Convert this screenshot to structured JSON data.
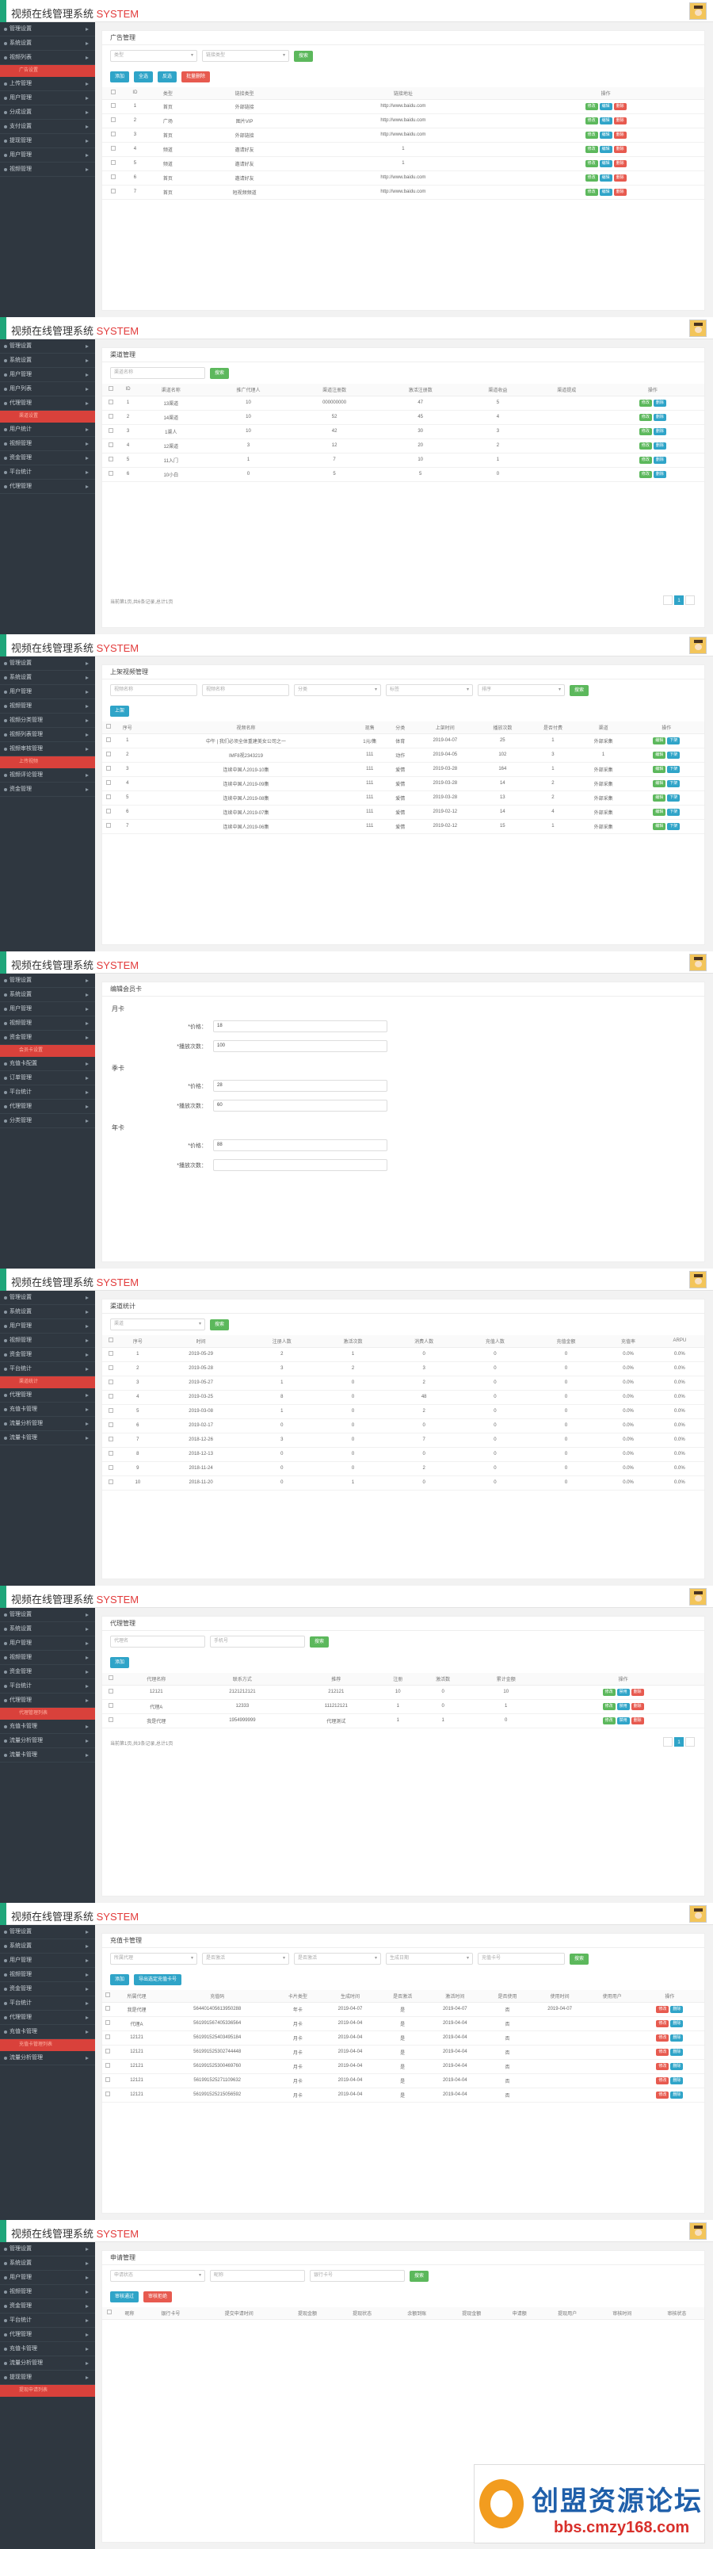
{
  "app": {
    "title": "视频在线管理系统",
    "title_en": "SYSTEM"
  },
  "watermark": {
    "brand": "创盟资源论坛",
    "url": "bbs.cmzy168.com"
  },
  "shot1": {
    "side": [
      "管理设置",
      "系统设置",
      "视频列表",
      "广告设置",
      "上传管理",
      "用户管理",
      "分成设置",
      "支付设置",
      "提现管理",
      "用户管理",
      "视频管理"
    ],
    "page_title": "广告管理",
    "filters": [
      "类型",
      "链接类型"
    ],
    "search": "搜索",
    "actions": [
      "添加",
      "全选",
      "反选",
      "批量删除"
    ],
    "headers": [
      "",
      "ID",
      "类型",
      "链接类型",
      "",
      "链接地址",
      "操作"
    ],
    "rows": [
      [
        "1",
        "首页",
        "外部链接",
        "",
        "http://www.baidu.com"
      ],
      [
        "2",
        "广场",
        "图片VIP",
        "",
        "http://www.baidu.com"
      ],
      [
        "3",
        "首页",
        "外部链接",
        "",
        "http://www.baidu.com"
      ],
      [
        "4",
        "频道",
        "邀请好友",
        "",
        "1"
      ],
      [
        "5",
        "频道",
        "邀请好友",
        "",
        "1"
      ],
      [
        "6",
        "首页",
        "邀请好友",
        "",
        "http://www.baidu.com"
      ],
      [
        "7",
        "首页",
        "短视频频道",
        "",
        "http://www.baidu.com"
      ]
    ],
    "ops": [
      "修改",
      "编辑",
      "删除"
    ]
  },
  "shot2": {
    "side": [
      "管理设置",
      "系统设置",
      "用户管理",
      "用户列表",
      "代理管理",
      "渠道设置",
      "用户统计",
      "视频管理",
      "资金管理",
      "平台统计",
      "代理管理"
    ],
    "page_title": "渠道管理",
    "placeholder": "渠道名称",
    "search": "搜索",
    "headers": [
      "",
      "ID",
      "渠道名称",
      "推广代理人",
      "渠道注册数",
      "激活注册数",
      "渠道收益",
      "渠道提成",
      "操作"
    ],
    "rows": [
      [
        "1",
        "13渠道",
        "10",
        "000000000",
        "47",
        "5"
      ],
      [
        "2",
        "14渠道",
        "10",
        "52",
        "45",
        "4"
      ],
      [
        "3",
        "1渠人",
        "10",
        "42",
        "30",
        "3"
      ],
      [
        "4",
        "12渠道",
        "3",
        "12",
        "20",
        "2"
      ],
      [
        "5",
        "11入门",
        "1",
        "7",
        "10",
        "1"
      ],
      [
        "6",
        "10小白",
        "0",
        "5",
        "5",
        "0"
      ]
    ],
    "ops": [
      "修改",
      "删除"
    ],
    "pinfo": "当前第1页,共6条记录,总计1页",
    "page": "1"
  },
  "shot3": {
    "side": [
      "管理设置",
      "系统设置",
      "用户管理",
      "视频管理",
      "视频分类管理",
      "视频列表管理",
      "视频审核管理",
      "上传视频",
      "视频评论管理",
      "资金管理"
    ],
    "page_title": "上架视频管理",
    "filters": [
      "视频名称",
      "视频名称",
      "分类",
      "标签",
      "排序"
    ],
    "search": "搜索",
    "add": "上架",
    "headers": [
      "",
      "序号",
      "视频名称",
      "现售",
      "分类",
      "上架时间",
      "播放次数",
      "是否付费",
      "渠道",
      "操作"
    ],
    "rows": [
      [
        "1",
        "中午 | 我们必须全体重建美女公司之一",
        "1元/集",
        "体育",
        "2019-04-07",
        "25",
        "1",
        "外部采集"
      ],
      [
        "2",
        "IMF8视2343219",
        "111",
        "动作",
        "2019-04-05",
        "102",
        "3",
        "1"
      ],
      [
        "3",
        "连续中国人2019-10集",
        "111",
        "爱情",
        "2019-03-28",
        "164",
        "1",
        "外部采集"
      ],
      [
        "4",
        "连续中国人2019-09集",
        "111",
        "爱情",
        "2019-03-28",
        "14",
        "2",
        "外部采集"
      ],
      [
        "5",
        "连续中国人2019-08集",
        "111",
        "爱情",
        "2019-03-28",
        "13",
        "2",
        "外部采集"
      ],
      [
        "6",
        "连续中国人2019-07集",
        "111",
        "爱情",
        "2019-02-12",
        "14",
        "4",
        "外部采集"
      ],
      [
        "7",
        "连续中国人2019-06集",
        "111",
        "爱情",
        "2019-02-12",
        "15",
        "1",
        "外部采集"
      ]
    ],
    "ops": [
      "编辑",
      "下架"
    ]
  },
  "shot4": {
    "side": [
      "管理设置",
      "系统设置",
      "用户管理",
      "视频管理",
      "资金管理",
      "会员卡设置",
      "充值卡配置",
      "订单管理",
      "平台统计",
      "代理管理",
      "分类管理"
    ],
    "page_title": "编辑会员卡",
    "groups": [
      {
        "name": "月卡",
        "price_label": "*价格：",
        "price": "18",
        "times_label": "*播放次数：",
        "times": "100"
      },
      {
        "name": "季卡",
        "price_label": "*价格：",
        "price": "28",
        "times_label": "*播放次数：",
        "times": "60"
      },
      {
        "name": "年卡",
        "price_label": "*价格：",
        "price": "88",
        "times_label": "*播放次数：",
        "times": ""
      }
    ]
  },
  "shot5": {
    "side": [
      "管理设置",
      "系统设置",
      "用户管理",
      "视频管理",
      "资金管理",
      "平台统计",
      "渠道统计",
      "代理管理",
      "充值卡管理",
      "流量分析管理",
      "流量卡管理"
    ],
    "page_title": "渠道统计",
    "filter": "渠道",
    "search": "搜索",
    "headers": [
      "",
      "序号",
      "时间",
      "注册人数",
      "激活次数",
      "消费人数",
      "充值人数",
      "充值金额",
      "充值率",
      "ARPU"
    ],
    "rows": [
      [
        "1",
        "2019-05-29",
        "2",
        "1",
        "0",
        "0",
        "0.0%"
      ],
      [
        "2",
        "2019-05-28",
        "3",
        "2",
        "3",
        "0",
        "0.0%"
      ],
      [
        "3",
        "2019-05-27",
        "1",
        "0",
        "2",
        "0",
        "0.0%"
      ],
      [
        "4",
        "2019-03-25",
        "8",
        "0",
        "48",
        "0",
        "0.0%"
      ],
      [
        "5",
        "2019-03-08",
        "1",
        "0",
        "2",
        "0",
        "0.0%"
      ],
      [
        "6",
        "2019-02-17",
        "0",
        "0",
        "0",
        "0",
        "0.0%"
      ],
      [
        "7",
        "2018-12-26",
        "3",
        "0",
        "7",
        "0",
        "0.0%"
      ],
      [
        "8",
        "2018-12-13",
        "0",
        "0",
        "0",
        "0",
        "0.0%"
      ],
      [
        "9",
        "2018-11-24",
        "0",
        "0",
        "2",
        "0",
        "0.0%"
      ],
      [
        "10",
        "2018-11-20",
        "0",
        "1",
        "0",
        "0",
        "0.0%"
      ]
    ]
  },
  "shot6": {
    "side": [
      "管理设置",
      "系统设置",
      "用户管理",
      "视频管理",
      "资金管理",
      "平台统计",
      "代理管理",
      "代理管理列表",
      "充值卡管理",
      "流量分析管理",
      "流量卡管理"
    ],
    "page_title": "代理管理",
    "filters": [
      "代理名",
      "手机号"
    ],
    "search": "搜索",
    "add": "添加",
    "headers": [
      "",
      "代理名称",
      "联系方式",
      "推荐",
      "注册",
      "激活数",
      "累计金额",
      "操作"
    ],
    "rows": [
      [
        "12121",
        "2121212121",
        "212121",
        "10",
        "0",
        "10"
      ],
      [
        "代理A",
        "12333",
        "111212121",
        "1",
        "0",
        "1"
      ],
      [
        "我是代理",
        "1954999999",
        "代理测试",
        "1",
        "1",
        "0"
      ]
    ],
    "ops": [
      "修改",
      "禁用",
      "删除"
    ],
    "pinfo": "当前第1页,共3条记录,总计1页",
    "page": "1"
  },
  "shot7": {
    "side": [
      "管理设置",
      "系统设置",
      "用户管理",
      "视频管理",
      "资金管理",
      "平台统计",
      "代理管理",
      "充值卡管理",
      "充值卡管理列表",
      "流量分析管理"
    ],
    "page_title": "充值卡管理",
    "filters": [
      "所属代理",
      "是否激活",
      "是否激活",
      "生成日期",
      "充值卡号"
    ],
    "search": "搜索",
    "actions": [
      "添加",
      "导出选定充值卡号"
    ],
    "headers": [
      "",
      "所属代理",
      "充值码",
      "卡片类型",
      "生成时间",
      "是否激活",
      "激活时间",
      "是否使用",
      "使用时间",
      "使用用户",
      "操作"
    ],
    "rows": [
      [
        "我是代理",
        "564401405613950288",
        "年卡",
        "2019-04-07",
        "是",
        "2019-04-07",
        "否",
        "2019-04-07"
      ],
      [
        "代理A",
        "561991567405336564",
        "月卡",
        "2019-04-04",
        "是",
        "2019-04-04",
        "否",
        ""
      ],
      [
        "12121",
        "561991525403495184",
        "月卡",
        "2019-04-04",
        "是",
        "2019-04-04",
        "否",
        ""
      ],
      [
        "12121",
        "561991525302744448",
        "月卡",
        "2019-04-04",
        "是",
        "2019-04-04",
        "否",
        ""
      ],
      [
        "12121",
        "561991525300469760",
        "月卡",
        "2019-04-04",
        "是",
        "2019-04-04",
        "否",
        ""
      ],
      [
        "12121",
        "561991525271109632",
        "月卡",
        "2019-04-04",
        "是",
        "2019-04-04",
        "否",
        ""
      ],
      [
        "12121",
        "561991525215056592",
        "月卡",
        "2019-04-04",
        "是",
        "2019-04-04",
        "否",
        ""
      ]
    ],
    "ops": [
      "修改",
      "删除"
    ]
  },
  "shot8": {
    "side": [
      "管理设置",
      "系统设置",
      "用户管理",
      "视频管理",
      "资金管理",
      "平台统计",
      "代理管理",
      "充值卡管理",
      "流量分析管理",
      "提现管理",
      "提现申请列表"
    ],
    "page_title": "申请管理",
    "filters": [
      "申请状态",
      "昵称",
      "银行卡号"
    ],
    "search": "搜索",
    "actions": [
      "审核通过",
      "审核拒绝"
    ],
    "headers": [
      "",
      "昵称",
      "银行卡号",
      "提交申请时间",
      "提现金额",
      "提现状态",
      "余额到账",
      "提现金额",
      "申请额",
      "提现用户",
      "审核时间",
      "审核状态"
    ]
  }
}
